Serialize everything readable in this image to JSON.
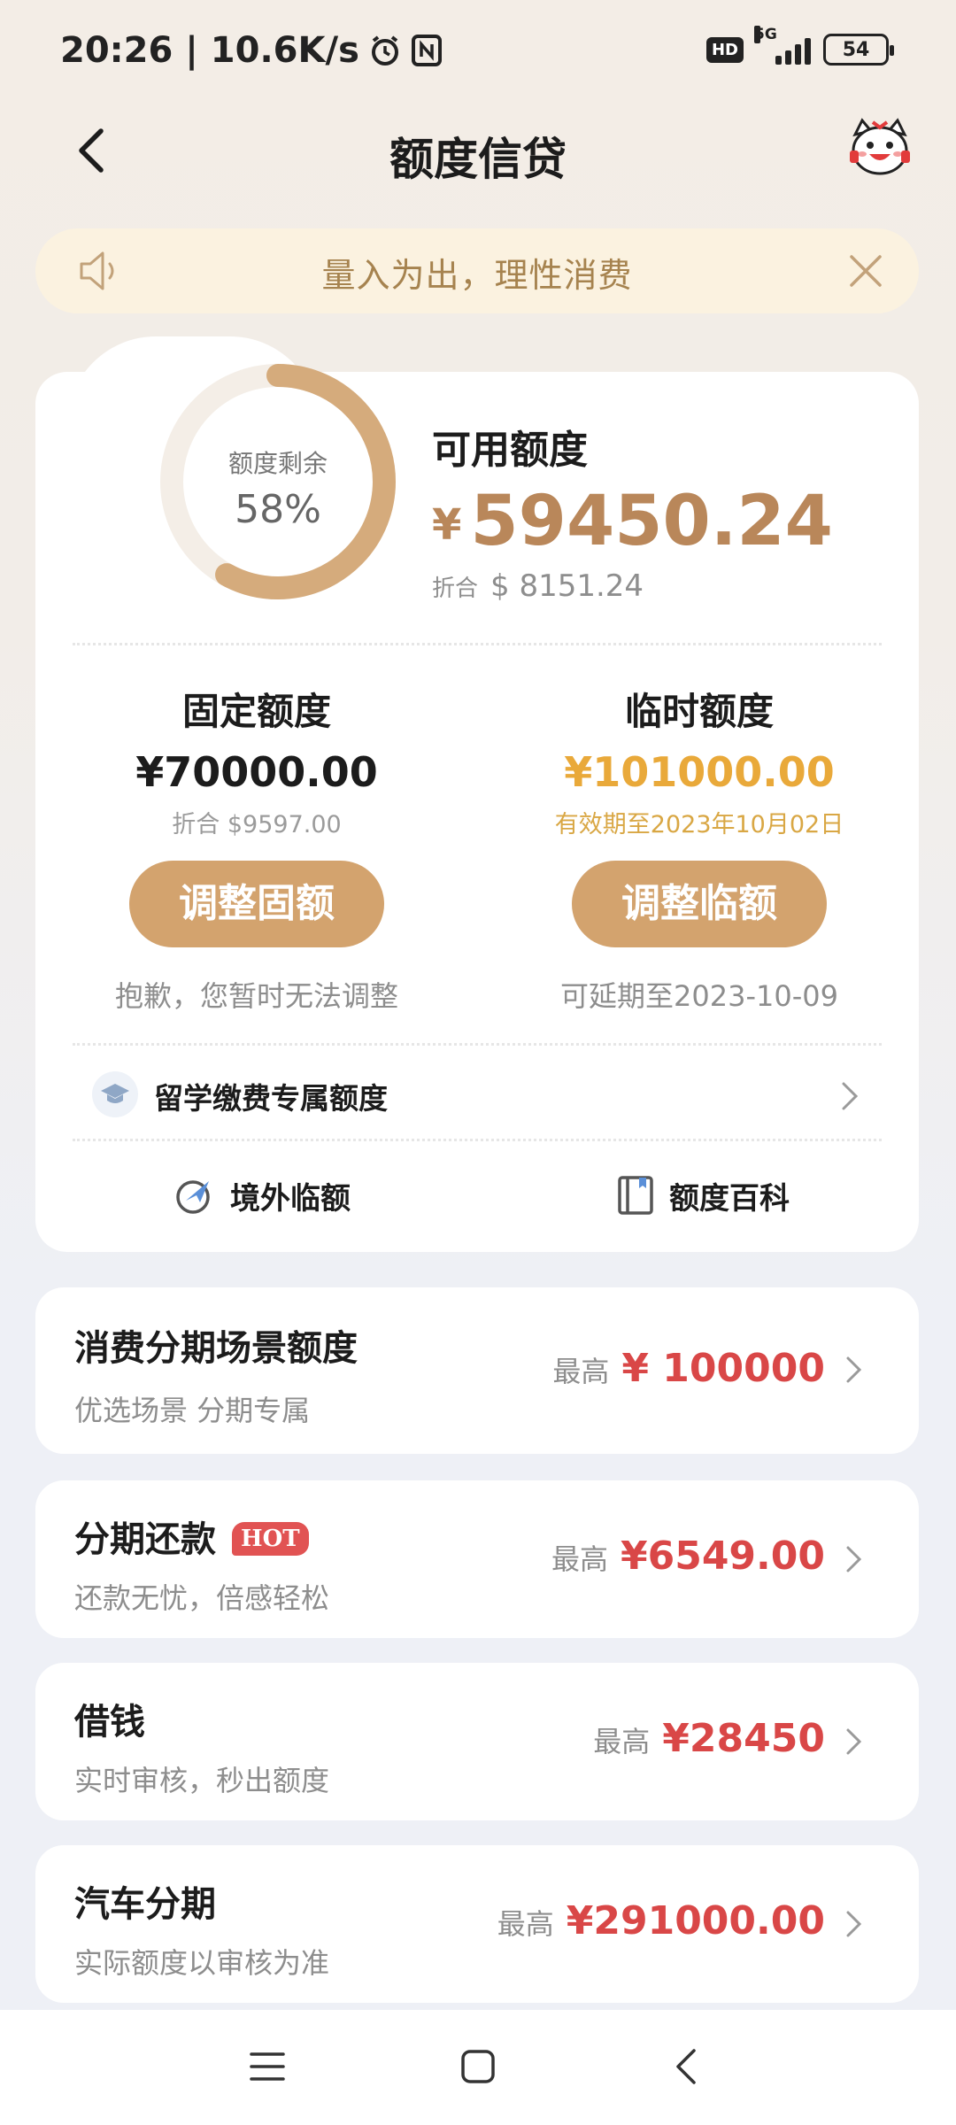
{
  "status_bar": {
    "time_speed": "20:26 | 10.6K/s",
    "network": "5G",
    "hd": "HD",
    "battery": "54"
  },
  "header": {
    "title": "额度信贷"
  },
  "notice": {
    "text": "量入为出，理性消费"
  },
  "summary": {
    "ring_label": "额度剩余",
    "ring_percent": "58%",
    "ring_fraction": 0.58,
    "available_title": "可用额度",
    "available_currency": "¥",
    "available_amount": "59450.24",
    "converted_label": "折合",
    "converted_value": "$ 8151.24"
  },
  "fixed": {
    "title": "固定额度",
    "amount": "¥70000.00",
    "sub": "折合 $9597.00",
    "button": "调整固额",
    "note": "抱歉，您暂时无法调整"
  },
  "temporary": {
    "title": "临时额度",
    "amount": "¥101000.00",
    "sub": "有效期至2023年10月02日",
    "button": "调整临额",
    "note": "可延期至2023-10-09"
  },
  "study": {
    "label": "留学缴费专属额度"
  },
  "tools": {
    "overseas": "境外临额",
    "wiki": "额度百科"
  },
  "cards": [
    {
      "title": "消费分期场景额度",
      "sub": "优选场景 分期专属",
      "prefix": "最高",
      "value": "¥ 100000"
    },
    {
      "title": "分期还款",
      "badge": "HOT",
      "sub": "还款无忧，倍感轻松",
      "prefix": "最高",
      "value": "¥6549.00"
    },
    {
      "title": "借钱",
      "sub": "实时审核，秒出额度",
      "prefix": "最高",
      "value": "¥28450"
    },
    {
      "title": "汽车分期",
      "sub": "实际额度以审核为准",
      "prefix": "最高",
      "value": "¥291000.00"
    }
  ],
  "colors": {
    "accent_gold": "#d3a36e",
    "amount_gold": "#b9875a",
    "temp_amber": "#e9a93a",
    "price_red": "#d94747"
  }
}
